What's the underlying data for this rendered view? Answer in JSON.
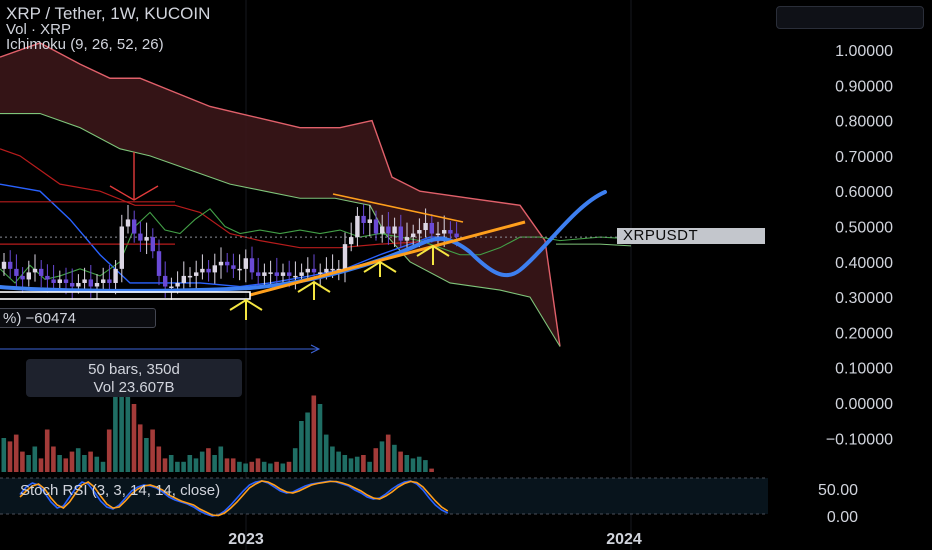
{
  "header": {
    "symbol": "XRP / Tether, 1W, KUCOIN",
    "volume": "Vol · XRP",
    "indicator": "Ichimoku (9, 26, 52, 26)"
  },
  "price_tag": "XRPUSDT",
  "measure": {
    "line1": "50 bars, 350d",
    "line2": "Vol 23.607B"
  },
  "pnl_label": "%) −60474",
  "stoch_label": "Stoch RSI (3, 3, 14, 14, close)",
  "colors": {
    "background": "#000000",
    "cloud_red": "#e0606a",
    "cloud_fill": "#3a1618",
    "tenkan": "#2962ff",
    "kijun": "#b71c1c",
    "chikou": "#43a047",
    "trend_orange": "#ff9f1c",
    "prediction_blue": "#3d7ff0",
    "annotation_yellow": "#f5e642",
    "bull": "#26a69a",
    "bear": "#ef5350"
  },
  "chart_data": [
    {
      "type": "candlestick",
      "title": "XRP / Tether, 1W, KUCOIN",
      "y_axis_ticks": [
        "1.00000",
        "0.90000",
        "0.80000",
        "0.70000",
        "0.60000",
        "0.50000",
        "0.40000",
        "0.30000",
        "0.20000",
        "0.10000",
        "0.00000",
        "−0.10000"
      ],
      "x_axis_ticks": [
        "2023",
        "2024"
      ],
      "ylim": [
        -0.1,
        1.0
      ],
      "last_price": 0.47,
      "close": [
        0.4,
        0.38,
        0.36,
        0.35,
        0.37,
        0.38,
        0.36,
        0.35,
        0.34,
        0.35,
        0.34,
        0.33,
        0.34,
        0.35,
        0.33,
        0.34,
        0.35,
        0.34,
        0.38,
        0.5,
        0.52,
        0.48,
        0.46,
        0.47,
        0.43,
        0.36,
        0.33,
        0.33,
        0.34,
        0.36,
        0.36,
        0.37,
        0.38,
        0.37,
        0.39,
        0.4,
        0.39,
        0.38,
        0.38,
        0.41,
        0.37,
        0.36,
        0.37,
        0.37,
        0.36,
        0.37,
        0.36,
        0.36,
        0.37,
        0.38,
        0.37,
        0.37,
        0.38,
        0.38,
        0.38,
        0.45,
        0.47,
        0.53,
        0.51,
        0.52,
        0.48,
        0.5,
        0.48,
        0.5,
        0.46,
        0.47,
        0.48,
        0.49,
        0.51,
        0.48,
        0.48,
        0.49,
        0.48,
        0.47
      ],
      "volume_bar_values_relative": [
        0.2,
        0.18,
        0.22,
        0.12,
        0.1,
        0.15,
        0.08,
        0.25,
        0.15,
        0.1,
        0.08,
        0.12,
        0.14,
        0.1,
        0.12,
        0.09,
        0.06,
        0.25,
        0.45,
        0.52,
        0.45,
        0.4,
        0.28,
        0.2,
        0.25,
        0.15,
        0.08,
        0.1,
        0.06,
        0.06,
        0.1,
        0.08,
        0.12,
        0.14,
        0.1,
        0.15,
        0.08,
        0.08,
        0.06,
        0.05,
        0.06,
        0.08,
        0.06,
        0.05,
        0.06,
        0.05,
        0.06,
        0.14,
        0.3,
        0.35,
        0.45,
        0.4,
        0.22,
        0.15,
        0.12,
        0.1,
        0.08,
        0.09,
        0.1,
        0.06,
        0.14,
        0.18,
        0.22,
        0.16,
        0.12,
        0.1,
        0.08,
        0.09,
        0.07,
        0.02
      ]
    },
    {
      "type": "line",
      "title": "Stoch RSI (3, 3, 14, 14, close)",
      "y_axis_ticks": [
        "50.00",
        "0.00"
      ],
      "series": [
        {
          "values": [
            55,
            70,
            78,
            74,
            58,
            40,
            28,
            32,
            50,
            68,
            80,
            76,
            60,
            42,
            30,
            26,
            34,
            48,
            62,
            70,
            74,
            72,
            68,
            60,
            50,
            44,
            40,
            36,
            30,
            22,
            16,
            12,
            14,
            22,
            34,
            48,
            62,
            74,
            80,
            82,
            78,
            70,
            62,
            58,
            60,
            66,
            72,
            76,
            78,
            80,
            82,
            80,
            76,
            72,
            64,
            58,
            50,
            46,
            48,
            56,
            66,
            74,
            80,
            82,
            76,
            64,
            48,
            34,
            24,
            18
          ]
        },
        {
          "values": [
            50,
            62,
            72,
            76,
            66,
            48,
            34,
            28,
            40,
            58,
            74,
            80,
            70,
            52,
            36,
            28,
            30,
            42,
            56,
            66,
            72,
            74,
            70,
            64,
            54,
            48,
            42,
            38,
            34,
            26,
            20,
            14,
            13,
            18,
            28,
            40,
            54,
            68,
            76,
            82,
            80,
            74,
            66,
            60,
            58,
            62,
            68,
            74,
            77,
            79,
            81,
            81,
            78,
            74,
            68,
            62,
            54,
            48,
            46,
            52,
            60,
            70,
            77,
            81,
            79,
            70,
            56,
            42,
            30,
            22
          ]
        }
      ]
    }
  ]
}
